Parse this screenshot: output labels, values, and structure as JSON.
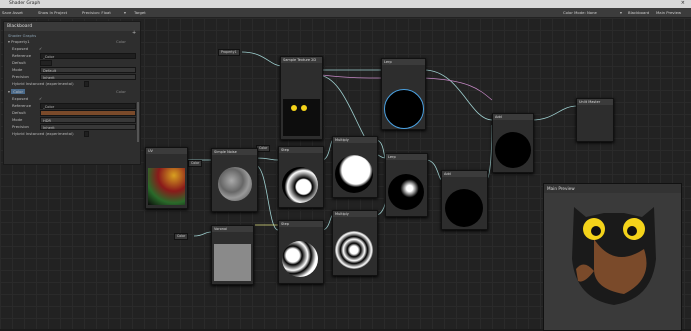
{
  "window": {
    "title": "Shader Graph",
    "close_glyph": "×"
  },
  "toolbar": {
    "left_items": [
      "Save Asset",
      "Show In Project",
      "Precision: Float",
      "Target"
    ],
    "right_items": [
      "Color Mode: None",
      "Blackboard",
      "Main Preview"
    ]
  },
  "blackboard": {
    "title": "Blackboard",
    "subtitle": "Shader Graphs",
    "properties": [
      {
        "name": "Property1",
        "type": "Color",
        "rows": [
          {
            "label": "Exposed",
            "value": "✓"
          },
          {
            "label": "Reference",
            "value": "_Color"
          },
          {
            "label": "Default",
            "value": ""
          },
          {
            "label": "Mode",
            "value": "Default"
          },
          {
            "label": "Precision",
            "value": "Inherit"
          },
          {
            "label": "Hybrid Instanced (experimental)",
            "value": ""
          }
        ]
      },
      {
        "name": "Color",
        "type": "Color",
        "rows": [
          {
            "label": "Exposed",
            "value": "✓"
          },
          {
            "label": "Reference",
            "value": "_Color"
          },
          {
            "label": "Default",
            "value": ""
          },
          {
            "label": "Mode",
            "value": "HDR"
          },
          {
            "label": "Precision",
            "value": "Inherit"
          },
          {
            "label": "Hybrid Instanced (experimental)",
            "value": ""
          }
        ]
      }
    ]
  },
  "nodes": [
    {
      "id": "uv",
      "title": "UV"
    },
    {
      "id": "noise1",
      "title": "Simple Noise"
    },
    {
      "id": "sample-texture",
      "title": "Sample Texture 2D"
    },
    {
      "id": "step1",
      "title": "Step"
    },
    {
      "id": "step2",
      "title": "Step"
    },
    {
      "id": "multiply1",
      "title": "Multiply"
    },
    {
      "id": "multiply2",
      "title": "Multiply"
    },
    {
      "id": "lerp1",
      "title": "Lerp"
    },
    {
      "id": "lerp2",
      "title": "Lerp"
    },
    {
      "id": "add1",
      "title": "Add"
    },
    {
      "id": "add2",
      "title": "Add"
    },
    {
      "id": "noise2",
      "title": "Voronoi"
    },
    {
      "id": "master",
      "title": "Unlit Master"
    }
  ],
  "property_pills": [
    "Property1",
    "Color",
    "Color",
    "Color"
  ],
  "main_preview": {
    "title": "Main Preview"
  },
  "colors": {
    "accent": "#4aa0e0",
    "owl_brown": "#7a4a2a",
    "owl_eye": "#f4d31a",
    "wire": "#9fd0d0"
  }
}
